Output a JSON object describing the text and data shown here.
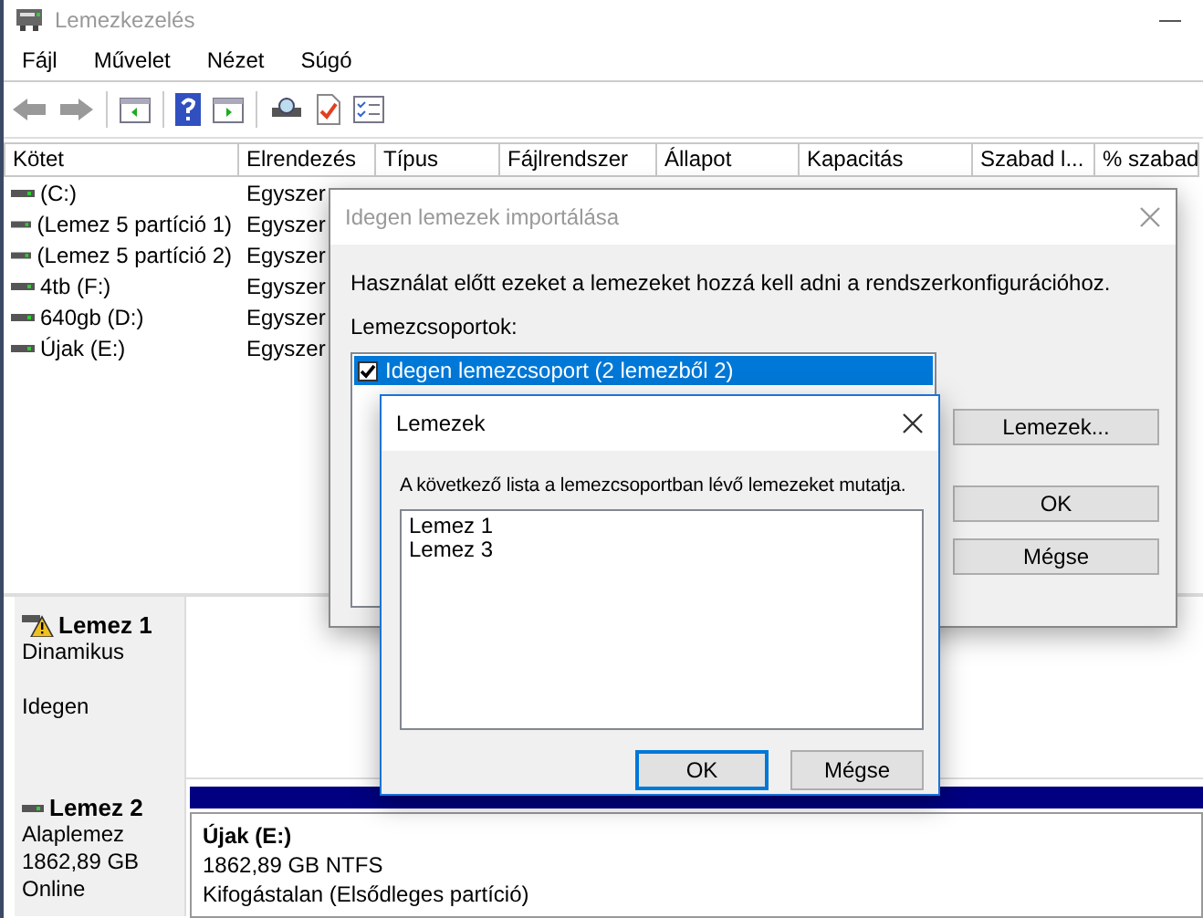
{
  "window": {
    "title": "Lemezkezelés"
  },
  "menu": [
    "Fájl",
    "Művelet",
    "Nézet",
    "Súgó"
  ],
  "volume_table": {
    "columns": [
      "Kötet",
      "Elrendezés",
      "Típus",
      "Fájlrendszer",
      "Állapot",
      "Kapacitás",
      "Szabad l...",
      "% szabad"
    ],
    "rows": [
      {
        "volume": "(C:)",
        "layout": "Egyszer"
      },
      {
        "volume": "(Lemez 5 partíció 1)",
        "layout": "Egyszer"
      },
      {
        "volume": "(Lemez 5 partíció 2)",
        "layout": "Egyszer"
      },
      {
        "volume": "4tb (F:)",
        "layout": "Egyszer"
      },
      {
        "volume": "640gb (D:)",
        "layout": "Egyszer"
      },
      {
        "volume": "Újak (E:)",
        "layout": "Egyszer"
      }
    ]
  },
  "disks": [
    {
      "name": "Lemez 1",
      "warning": true,
      "type": "Dinamikus",
      "status": "Idegen"
    },
    {
      "name": "Lemez 2",
      "warning": false,
      "type": "Alaplemez",
      "size": "1862,89 GB",
      "status": "Online",
      "partitions": [
        {
          "name": "Újak  (E:)",
          "size": "1862,89 GB NTFS",
          "health": "Kifogástalan (Elsődleges partíció)"
        }
      ]
    }
  ],
  "import_dialog": {
    "title": "Idegen lemezek importálása",
    "active": false,
    "message": "Használat előtt ezeket a lemezeket hozzá kell adni a rendszerkonfigurációhoz.",
    "list_label": "Lemezcsoportok:",
    "groups": [
      {
        "label": "Idegen lemezcsoport (2 lemezből 2)",
        "checked": true,
        "selected": true
      }
    ],
    "buttons": [
      {
        "label": "Lemezek..."
      },
      {
        "label": "OK"
      },
      {
        "label": "Mégse"
      }
    ]
  },
  "disks_dialog": {
    "title": "Lemezek",
    "active": true,
    "message": "A következő lista a lemezcsoportban lévő lemezeket mutatja.",
    "items": [
      "Lemez 1",
      "Lemez 3"
    ],
    "buttons": [
      {
        "label": "OK",
        "default": true
      },
      {
        "label": "Mégse",
        "default": false
      }
    ]
  }
}
